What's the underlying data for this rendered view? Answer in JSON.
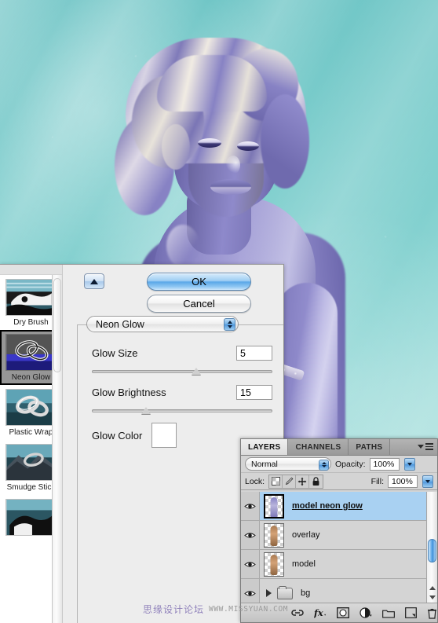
{
  "artwork": {
    "description": "purple-toned female model on teal background",
    "background_color": "#6fc5c5",
    "figure_color": "#8b87c8"
  },
  "filter_dialog": {
    "collapse_icon": "triangle-up-icon",
    "ok_label": "OK",
    "cancel_label": "Cancel",
    "filter_select": {
      "selected": "Neon Glow",
      "stepper_icon": "stepper-updown-icon"
    },
    "controls": [
      {
        "label": "Glow Size",
        "value": "5",
        "slider_percent": 58
      },
      {
        "label": "Glow Brightness",
        "value": "15",
        "slider_percent": 30
      }
    ],
    "color_control": {
      "label": "Glow Color",
      "color": "#0b27ee"
    },
    "thumbnails": [
      {
        "label": "Dry Brush",
        "selected": false
      },
      {
        "label": "Neon Glow",
        "selected": true
      },
      {
        "label": "Plastic Wrap",
        "selected": false
      },
      {
        "label": "Smudge Stick",
        "selected": false
      },
      {
        "label": "",
        "selected": false
      }
    ]
  },
  "layers_panel": {
    "tabs": [
      {
        "label": "LAYERS",
        "active": true
      },
      {
        "label": "CHANNELS",
        "active": false
      },
      {
        "label": "PATHS",
        "active": false
      }
    ],
    "panel_menu_icon": "panel-menu-icon",
    "blend_mode": "Normal",
    "opacity_label": "Opacity:",
    "opacity_value": "100%",
    "lock_label": "Lock:",
    "lock_icons": [
      "lock-transparency-icon",
      "lock-brush-icon",
      "lock-move-icon",
      "lock-all-icon"
    ],
    "fill_label": "Fill:",
    "fill_value": "100%",
    "layers": [
      {
        "name": "model neon glow",
        "selected": true,
        "type": "layer",
        "thumb": "purple",
        "visible": true
      },
      {
        "name": "overlay",
        "selected": false,
        "type": "layer",
        "thumb": "skin",
        "visible": true
      },
      {
        "name": "model",
        "selected": false,
        "type": "layer",
        "thumb": "skin",
        "visible": true
      },
      {
        "name": "bg",
        "selected": false,
        "type": "group",
        "thumb": "folder",
        "visible": true
      }
    ],
    "footer_buttons": [
      "link-layers-icon",
      "layer-style-fx-icon",
      "add-layer-mask-icon",
      "new-adjustment-layer-icon",
      "new-group-icon",
      "new-layer-icon",
      "delete-layer-icon"
    ]
  },
  "watermark": {
    "chinese": "思缘设计论坛",
    "url": "WWW.MISSYUAN.COM"
  }
}
